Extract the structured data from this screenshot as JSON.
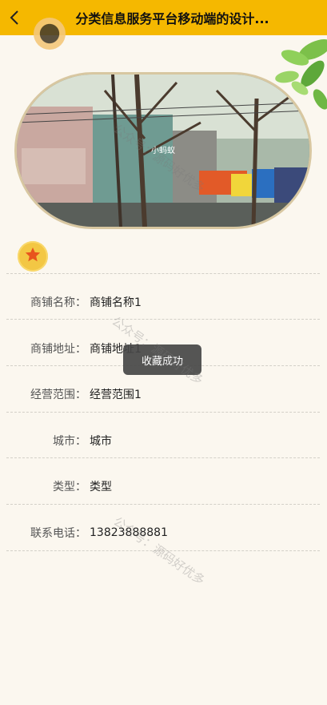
{
  "header": {
    "title": "分类信息服务平台移动端的设计...",
    "back_icon": "chevron-left-icon",
    "background_color": "#f5b800"
  },
  "hero": {
    "image_alt": "street storefront photo",
    "shop_sign_text": "小蚂蚁"
  },
  "favorite": {
    "icon": "star-icon",
    "color": "#f3c744"
  },
  "details": [
    {
      "label": "商铺名称",
      "value": "商铺名称1"
    },
    {
      "label": "商铺地址",
      "value": "商铺地址1"
    },
    {
      "label": "经营范围",
      "value": "经营范围1"
    },
    {
      "label": "城市",
      "value": "城市"
    },
    {
      "label": "类型",
      "value": "类型"
    },
    {
      "label": "联系电话",
      "value": "13823888881"
    }
  ],
  "toast": {
    "text": "收藏成功"
  },
  "watermarks": [
    {
      "text": "公众号：源码好优多"
    },
    {
      "text": "公众号：源码好优多"
    },
    {
      "text": "公众号：源码好优多"
    }
  ]
}
